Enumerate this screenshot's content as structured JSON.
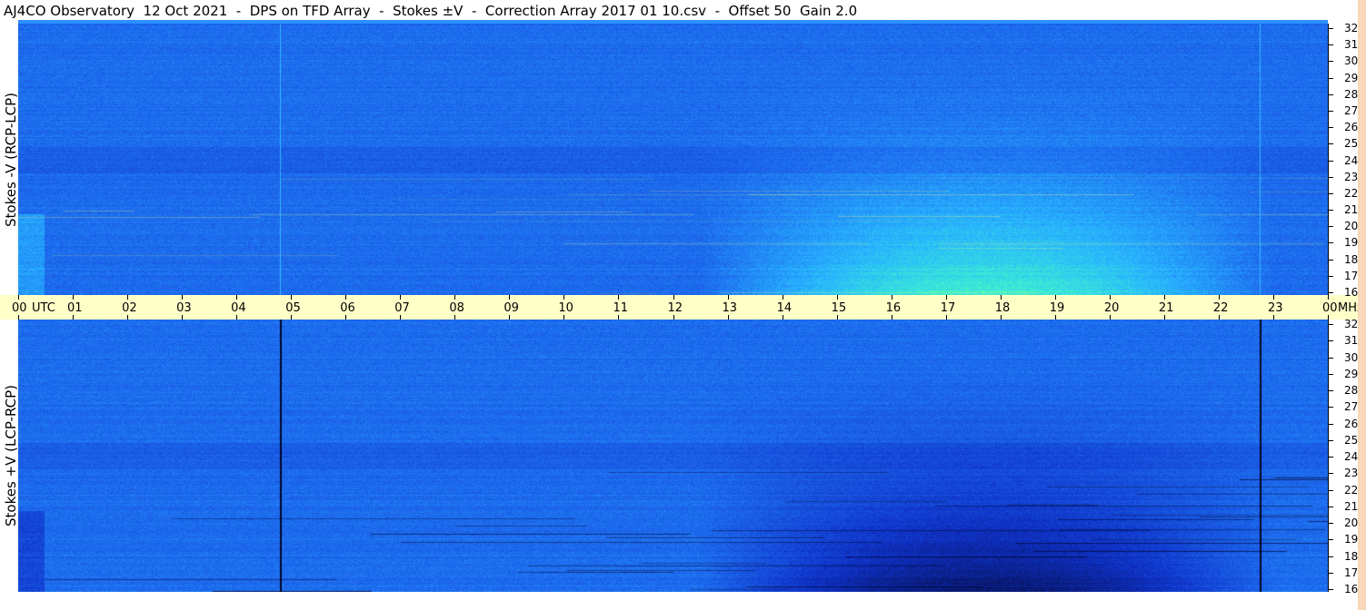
{
  "title": "AJ4CO Observatory  12 Oct 2021  -  DPS on TFD Array  -  Stokes ±V  -  Correction Array 2017 01 10.csv  -  Offset 50  Gain 2.0",
  "chart_data": {
    "type": "heatmap",
    "panels": [
      {
        "name": "Stokes -V (RCP-LCP)",
        "ylabel": "Stokes -V (RCP-LCP)",
        "ylim": [
          16,
          32
        ]
      },
      {
        "name": "Stokes +V (LCP-RCP)",
        "ylabel": "Stokes +V (LCP-RCP)",
        "ylim": [
          16,
          32
        ]
      }
    ],
    "x_ticks": [
      "00",
      "01",
      "02",
      "03",
      "04",
      "05",
      "06",
      "07",
      "08",
      "09",
      "10",
      "11",
      "12",
      "13",
      "14",
      "15",
      "16",
      "17",
      "18",
      "19",
      "20",
      "21",
      "22",
      "23",
      "00"
    ],
    "x_unit": "UTC",
    "y_ticks": [
      16,
      17,
      18,
      19,
      20,
      21,
      22,
      23,
      24,
      25,
      26,
      27,
      28,
      29,
      30,
      31,
      32
    ],
    "y_unit": "MHz",
    "xlim": [
      0,
      24
    ],
    "colors": {
      "background": "#1a5fe0",
      "bright": "#40ffc0",
      "dark": "#0a1a50",
      "timebar": "#ffffc8"
    }
  }
}
